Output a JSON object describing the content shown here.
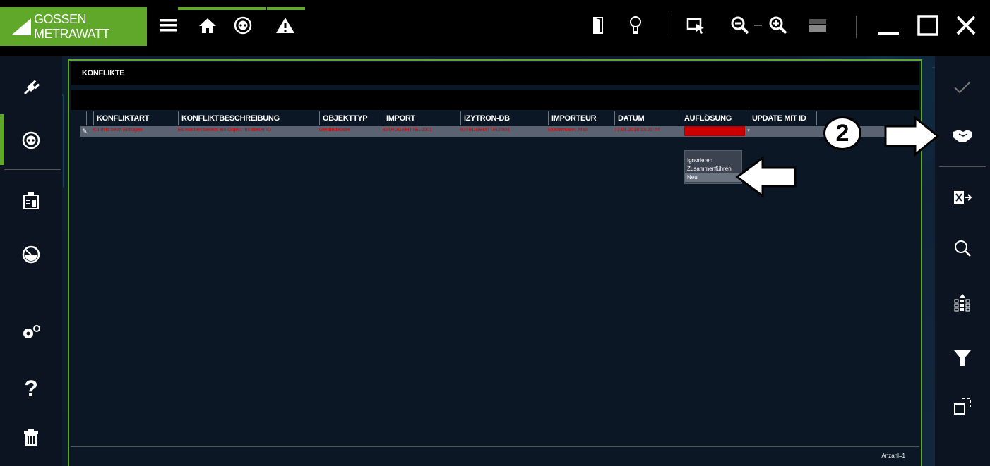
{
  "brand": {
    "name": "GOSSEN METRAWATT"
  },
  "toolbar": {
    "icons": [
      "menu-icon",
      "home-icon",
      "socket-icon",
      "warning-icon",
      "door-icon",
      "lightbulb-icon",
      "select-icon",
      "zoom-out-icon",
      "zoom-in-icon",
      "layout-icon",
      "minimize-icon",
      "maximize-icon",
      "close-icon"
    ],
    "zoom_separator": "–"
  },
  "left_sidebar": {
    "icons": [
      "plug-icon",
      "socket-icon",
      "building-icon",
      "gauge-icon",
      "settings-icon",
      "help-icon",
      "trash-icon"
    ],
    "help_glyph": "?"
  },
  "right_sidebar": {
    "icons": [
      "check-icon",
      "handshake-icon",
      "excel-export-icon",
      "search-icon",
      "columns-icon",
      "filter-icon",
      "expand-icon"
    ]
  },
  "dialog": {
    "title": "KONFLIKTE",
    "columns": [
      "KONFLIKTART",
      "KONFLIKTBESCHREIBUNG",
      "OBJEKTTYP",
      "IMPORT",
      "IZYTRON-DB",
      "IMPORTEUR",
      "DATUM",
      "AUFLÖSUNG",
      "UPDATE MIT ID"
    ],
    "row": {
      "konfliktart": "Konflikt beim Einfügen",
      "beschreibung": "Es existiert bereits ein Objekt mit dieser ID",
      "objekttyp": "Gerätedetailer",
      "import": "IDTRDGEMTTEL0001",
      "izytron": "IDTRDGEMTTEL0001",
      "importeur": "Mustermann, Max",
      "datum": "17.01.2018 13:23:44",
      "aufloesung": "",
      "update_mit_id": ""
    },
    "dropdown_options": [
      "Ignorieren",
      "Zusammenführen",
      "Neu"
    ],
    "count": "Anzahl=1"
  },
  "annotation": {
    "step": "2"
  },
  "colors": {
    "accent": "#5fa829",
    "error": "#e00000",
    "row": "#5b6271"
  }
}
